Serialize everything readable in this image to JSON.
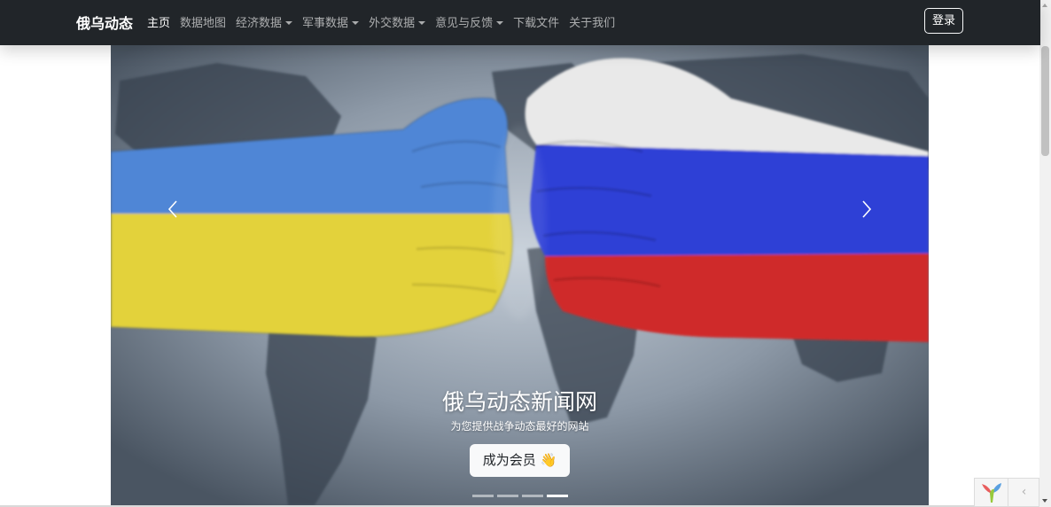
{
  "navbar": {
    "brand": "俄乌动态",
    "items": [
      {
        "label": "主页",
        "active": true,
        "dropdown": false
      },
      {
        "label": "数据地图",
        "active": false,
        "dropdown": false
      },
      {
        "label": "经济数据",
        "active": false,
        "dropdown": true
      },
      {
        "label": "军事数据",
        "active": false,
        "dropdown": true
      },
      {
        "label": "外交数据",
        "active": false,
        "dropdown": true
      },
      {
        "label": "意见与反馈",
        "active": false,
        "dropdown": true
      },
      {
        "label": "下载文件",
        "active": false,
        "dropdown": false
      },
      {
        "label": "关于我们",
        "active": false,
        "dropdown": false
      }
    ],
    "login_label": "登录"
  },
  "carousel": {
    "title": "俄乌动态新闻网",
    "subtitle": "为您提供战争动态最好的网站",
    "cta_label": "成为会员",
    "cta_emoji": "👋",
    "slide_count": 4,
    "active_slide": 4,
    "prev_icon": "chevron-left-icon",
    "next_icon": "chevron-right-icon"
  },
  "colors": {
    "navbar_bg": "#212529",
    "ukraine_blue": "#4f86d6",
    "ukraine_yellow": "#e3d23a",
    "russia_white": "#e9e9e9",
    "russia_blue": "#2f3fd6",
    "russia_red": "#cf2a2a"
  },
  "debug_toolbar": {
    "logo_icon": "yii-logo-icon",
    "toggle_label": "‹"
  }
}
